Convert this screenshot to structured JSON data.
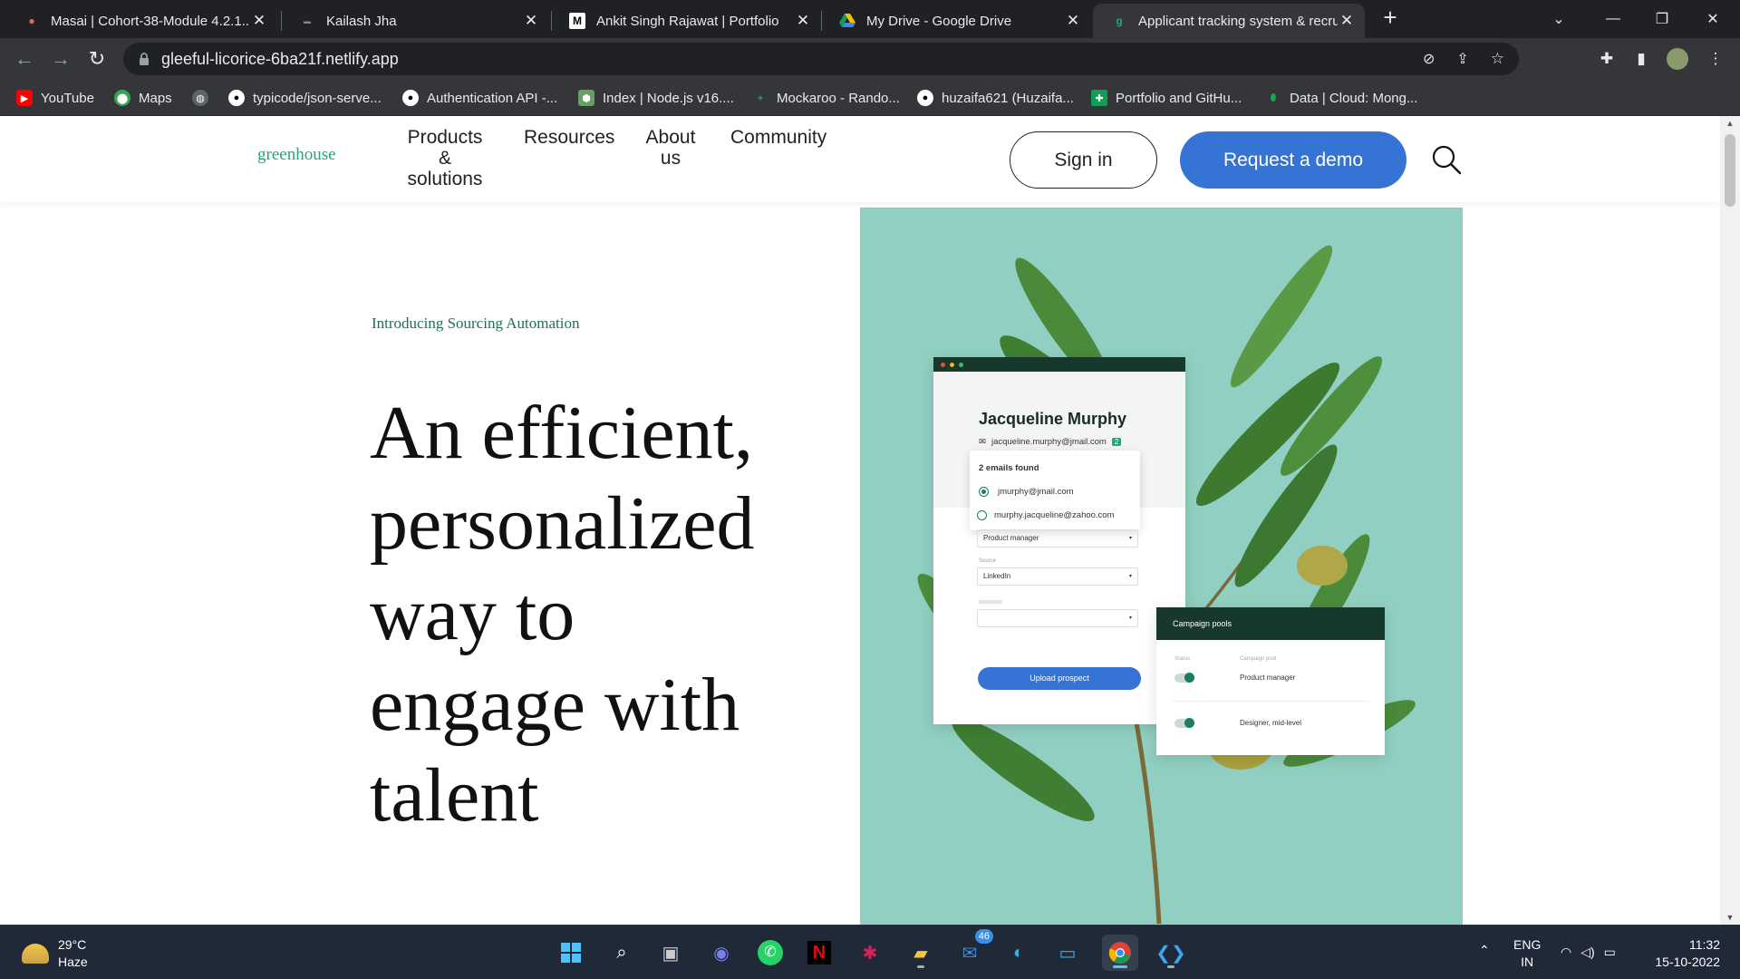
{
  "browser": {
    "tabs": [
      {
        "title": "Masai | Cohort-38-Module 4.2.1...",
        "favicon": "masai-icon",
        "active": false
      },
      {
        "title": "Kailash Jha",
        "favicon": "site-icon",
        "active": false
      },
      {
        "title": "Ankit Singh Rajawat | Portfolio",
        "favicon": "m-logo-icon",
        "active": false
      },
      {
        "title": "My Drive - Google Drive",
        "favicon": "google-drive-icon",
        "active": false
      },
      {
        "title": "Applicant tracking system & recru",
        "favicon": "greenhouse-icon",
        "active": true
      }
    ],
    "new_tab": "+",
    "url": "gleeful-licorice-6ba21f.netlify.app",
    "bookmarks": [
      {
        "label": "YouTube",
        "icon": "youtube-icon",
        "color": "#ff0000"
      },
      {
        "label": "Maps",
        "icon": "maps-icon",
        "color": "#34a853"
      },
      {
        "label": "",
        "icon": "globe-icon",
        "color": "#5f6368"
      },
      {
        "label": "typicode/json-serve...",
        "icon": "github-icon",
        "color": "#ffffff"
      },
      {
        "label": "Authentication API -...",
        "icon": "github-icon",
        "color": "#ffffff"
      },
      {
        "label": "Index | Node.js v16....",
        "icon": "nodejs-icon",
        "color": "#68a063"
      },
      {
        "label": "Mockaroo - Rando...",
        "icon": "mockaroo-icon",
        "color": "#2e8b57"
      },
      {
        "label": "huzaifa621 (Huzaifa...",
        "icon": "github-icon",
        "color": "#ffffff"
      },
      {
        "label": "Portfolio and GitHu...",
        "icon": "sheets-icon",
        "color": "#0f9d58"
      },
      {
        "label": "Data | Cloud: Mong...",
        "icon": "mongodb-icon",
        "color": "#13aa52"
      }
    ]
  },
  "site": {
    "logo": "greenhouse",
    "nav": [
      {
        "label": "Products\n&\nsolutions"
      },
      {
        "label": "Resources"
      },
      {
        "label": "About\nus"
      },
      {
        "label": "Community"
      }
    ],
    "signin_label": "Sign in",
    "demo_label": "Request a demo"
  },
  "hero": {
    "eyebrow": "Introducing Sourcing Automation",
    "headline": "An efficient, personalized way to engage with talent",
    "mock": {
      "candidate_name": "Jacqueline Murphy",
      "candidate_email": "jacqueline.murphy@jmail.com",
      "email_count": "2",
      "emails_found": "2 emails found",
      "email_option_1": "jmurphy@jmail.com",
      "email_option_2": "murphy.jacqueline@zahoo.com",
      "job_field": "Product manager",
      "source_label": "Source",
      "source_value": "LinkedIn",
      "upload_label": "Upload prospect",
      "campaign_title": "Campaign pools",
      "status_header": "Status",
      "pool_header": "Campaign pool",
      "pool_1": "Product manager",
      "pool_2": "Designer, mid-level"
    }
  },
  "taskbar": {
    "temperature": "29°C",
    "weather": "Haze",
    "mail_badge": "46",
    "language_1": "ENG",
    "language_2": "IN",
    "time": "11:32",
    "date": "15-10-2022"
  }
}
